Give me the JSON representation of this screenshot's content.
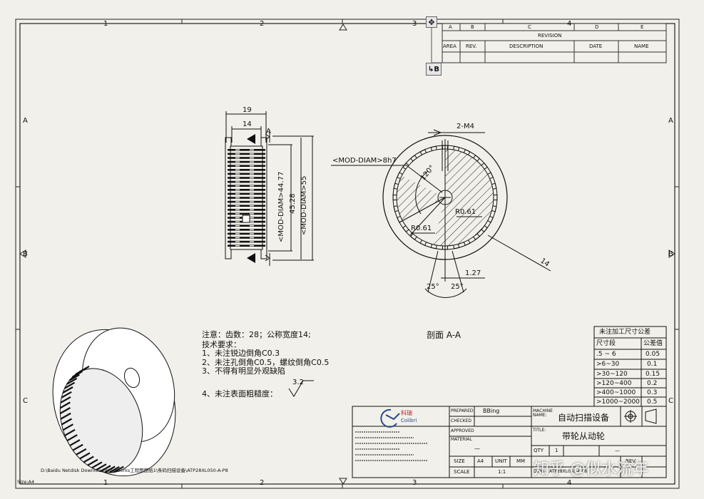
{
  "zones": {
    "top": [
      "1",
      "2",
      "3",
      "4"
    ],
    "bottom": [
      "1",
      "2",
      "3",
      "4"
    ],
    "left": [
      "A",
      "B",
      "C"
    ],
    "right": [
      "A",
      "B",
      "C"
    ]
  },
  "revision_table": {
    "cols": [
      "A",
      "B",
      "C",
      "D",
      "E"
    ],
    "title": "REVISION",
    "headers": [
      "AREA",
      "REV.",
      "DESCRIPTION",
      "DATE",
      "NAME"
    ],
    "move_icon": "move-arrows-icon",
    "anchor_label": "↳B"
  },
  "front_view": {
    "dim_19": "19",
    "dim_14": "14",
    "dim_mod44": "<MOD-DIAM>44.77",
    "dim_4528": "45.28",
    "dim_mod55": "<MOD-DIAM>55",
    "section_a": "A"
  },
  "section_view": {
    "dim_2m4": "2-M4",
    "dim_mod8h7": "<MOD-DIAM>8h7",
    "angle_120": "120°",
    "r061_a": "R0.61",
    "r061_b": "R0.61",
    "dim_14": "14",
    "dim_127": "1.27",
    "angle_25_a": "25°",
    "angle_25_b": "25°",
    "caption": "剖面 A-A"
  },
  "notes": [
    "注意：齿数：28；公称宽度14;",
    "技术要求：",
    "1、未注锐边倒角C0.3",
    "2、未注孔倒角C0.5，螺纹倒角C0.5",
    "3、不得有明显外观缺陷",
    "4、未注表面粗糙度："
  ],
  "roughness_value": "3.2",
  "tolerance_table": {
    "title": "未注加工尺寸公差",
    "headers": [
      "尺寸段",
      "公差值"
    ],
    "rows": [
      [
        ".5 ~ 6",
        "0.05"
      ],
      [
        ">6~30",
        "0.1"
      ],
      [
        ">30~120",
        "0.15"
      ],
      [
        ">120~400",
        "0.2"
      ],
      [
        ">400~1000",
        "0.3"
      ],
      [
        ">1000~2000",
        "0.5"
      ]
    ]
  },
  "title_block": {
    "logo_cn": "科瑞",
    "logo_en": "Colibri",
    "prepared_label": "PREPARED",
    "prepared_value": "BBing",
    "checked_label": "CHECKED",
    "approved_label": "APPROVED",
    "material_label": "MATERIAL",
    "material_value": "—",
    "machine_label": "MACHINE NAME:",
    "machine_value": "自动扫描设备",
    "title_label": "TITLE:",
    "title_value": "带轮从动轮",
    "qty_label": "QTY",
    "qty_value": "1",
    "weight_value": "—",
    "size_label": "SIZE",
    "size_value": "A4",
    "unit_label": "UNIT",
    "unit_value": "MM",
    "scale_label": "SCALE",
    "scale_value": "1:1",
    "dwg_label": "DWG",
    "dwg_value": "ATP28XL050-A-P8",
    "rev_label": "REV.",
    "path": "D:\\Baidu Netdisk Download\\solidworks工程图图纸1\\条码扫描设备\\ATP28XL050-A-P8"
  },
  "footer_size": "Size:A4",
  "watermark": "知乎 @似水流年"
}
